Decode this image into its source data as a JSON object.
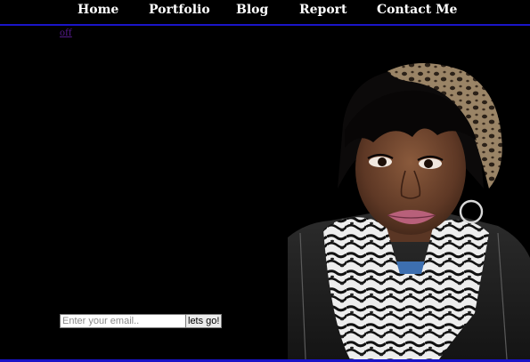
{
  "nav": {
    "items": [
      {
        "label": "Home"
      },
      {
        "label": "Portfolio"
      },
      {
        "label": "Blog"
      },
      {
        "label": "Report"
      },
      {
        "label": "Contact Me"
      }
    ]
  },
  "toggle_link": "off",
  "newsletter": {
    "placeholder": "Enter your email..",
    "button_label": "lets go!"
  },
  "colors": {
    "background": "#000000",
    "nav_border": "#1a14c8",
    "nav_text": "#ffffff",
    "visited_link": "#551a8b"
  },
  "photo": {
    "icon": "portrait-photo"
  }
}
